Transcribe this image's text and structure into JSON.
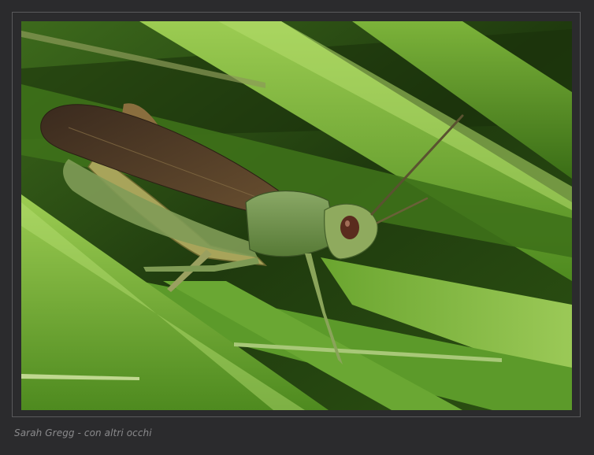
{
  "photo": {
    "subject": "grasshopper on grass blades",
    "colors": {
      "background": "#2b2b2d",
      "frame_border": "#5a5a5c",
      "caption_text": "#8a8a8c",
      "grass_dark": "#2f5a14",
      "grass_light": "#8fc24a",
      "insect_body": "#6f8a4a",
      "insect_wing": "#4a3a28"
    }
  },
  "caption": {
    "text": "Sarah Gregg - con altri occhi"
  }
}
